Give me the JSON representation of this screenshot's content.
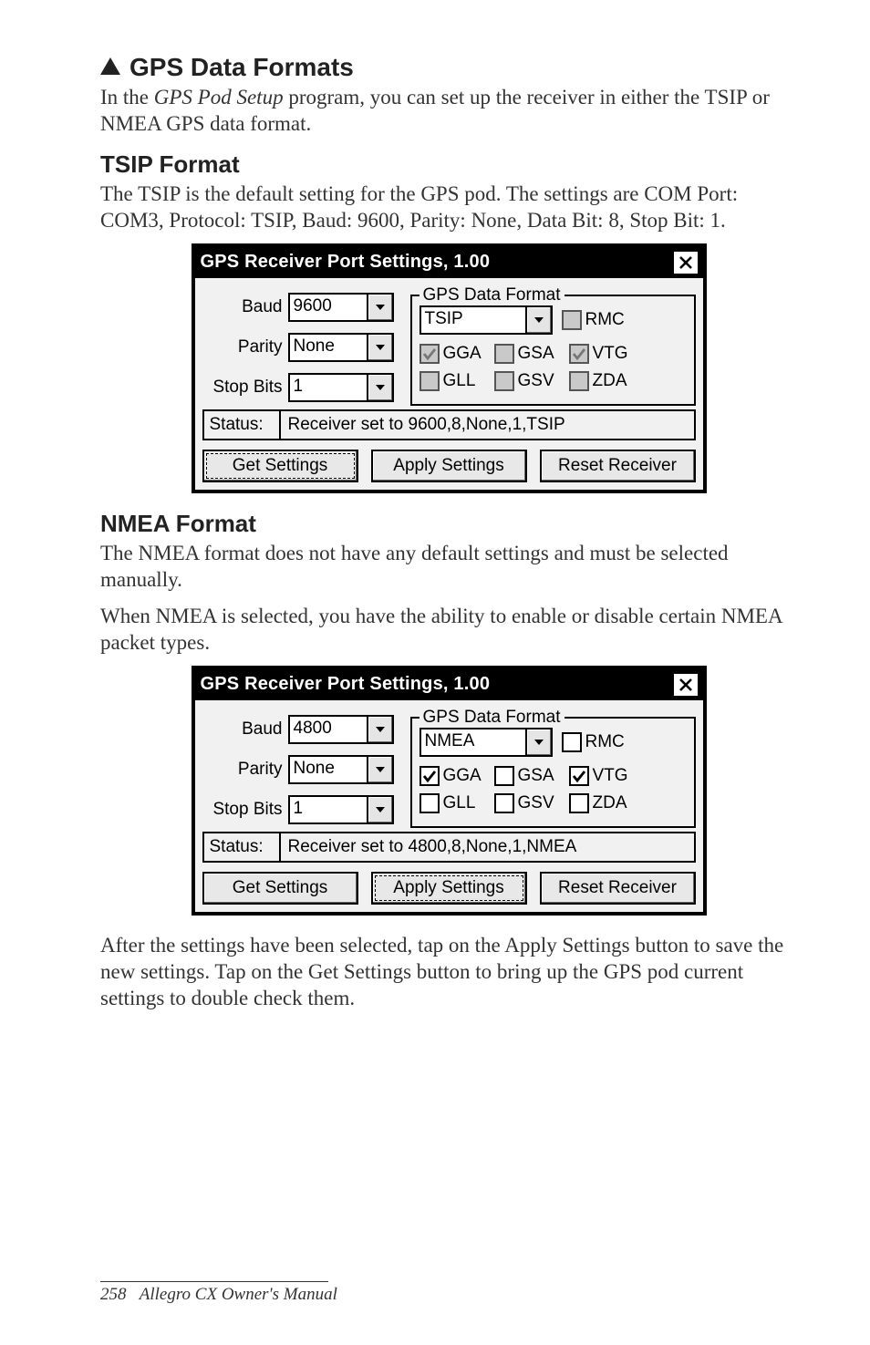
{
  "section": {
    "heading": "GPS Data Formats",
    "intro_a": "In the ",
    "intro_italic": "GPS Pod Setup",
    "intro_b": " program, you can set up the receiver in either the TSIP or NMEA GPS data format."
  },
  "tsip": {
    "heading": "TSIP Format",
    "para": "The TSIP is the default setting for the GPS pod. The settings are COM Port: COM3, Protocol: TSIP, Baud: 9600, Parity: None, Data Bit: 8, Stop Bit: 1."
  },
  "nmea": {
    "heading": "NMEA Format",
    "para1": "The NMEA format does not have any default settings and must be selected manually.",
    "para2": "When NMEA is selected, you have the ability to enable or disable certain NMEA packet types."
  },
  "after": "After the settings have been selected, tap on the Apply Settings button to save the new settings. Tap on the Get Settings button to bring up the GPS pod current settings to double check them.",
  "dialog_common": {
    "title": "GPS Receiver Port Settings, 1.00",
    "labels": {
      "baud": "Baud",
      "parity": "Parity",
      "stopbits": "Stop Bits",
      "status": "Status:",
      "group": "GPS Data Format"
    },
    "buttons": {
      "get": "Get Settings",
      "apply": "Apply Settings",
      "reset": "Reset Receiver"
    },
    "checks": {
      "rmc": "RMC",
      "gga": "GGA",
      "gsa": "GSA",
      "vtg": "VTG",
      "gll": "GLL",
      "gsv": "GSV",
      "zda": "ZDA"
    }
  },
  "dialog1": {
    "baud": "9600",
    "parity": "None",
    "stopbits": "1",
    "format": "TSIP",
    "status": "Receiver set to 9600,8,None,1,TSIP"
  },
  "dialog2": {
    "baud": "4800",
    "parity": "None",
    "stopbits": "1",
    "format": "NMEA",
    "status": "Receiver set to 4800,8,None,1,NMEA"
  },
  "footer": {
    "page": "258",
    "book": "Allegro CX Owner's Manual"
  }
}
